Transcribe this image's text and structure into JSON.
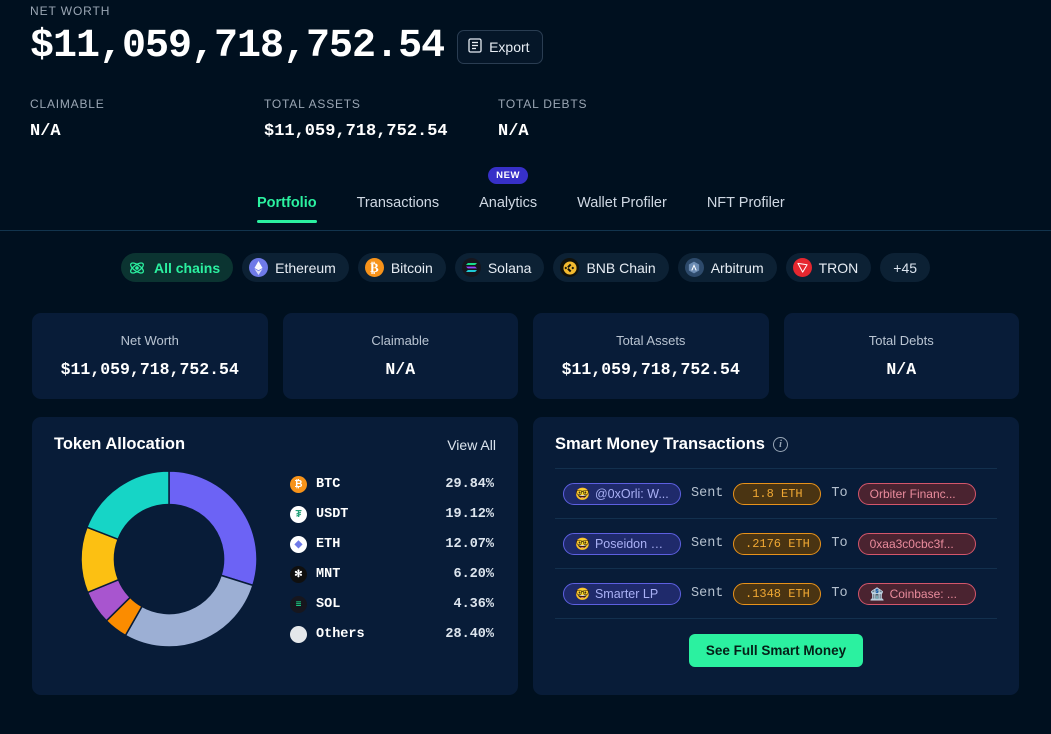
{
  "header": {
    "net_worth_label": "NET WORTH",
    "net_worth_value": "$11,059,718,752.54",
    "export_label": "Export",
    "sub_stats": [
      {
        "label": "CLAIMABLE",
        "value": "N/A"
      },
      {
        "label": "TOTAL ASSETS",
        "value": "$11,059,718,752.54"
      },
      {
        "label": "TOTAL DEBTS",
        "value": "N/A"
      }
    ]
  },
  "tabs": {
    "new_badge": "NEW",
    "items": [
      {
        "label": "Portfolio",
        "active": true
      },
      {
        "label": "Transactions",
        "active": false
      },
      {
        "label": "Analytics",
        "active": false
      },
      {
        "label": "Wallet Profiler",
        "active": false
      },
      {
        "label": "NFT Profiler",
        "active": false
      }
    ]
  },
  "chains": [
    {
      "label": "All chains",
      "icon": "atom-icon",
      "color": "#2bf1a0",
      "active": true
    },
    {
      "label": "Ethereum",
      "icon": "ethereum-icon",
      "color": "#6f7ae8",
      "active": false
    },
    {
      "label": "Bitcoin",
      "icon": "bitcoin-icon",
      "color": "#f7931a",
      "active": false
    },
    {
      "label": "Solana",
      "icon": "solana-icon",
      "color": "#1a1a2e",
      "active": false
    },
    {
      "label": "BNB Chain",
      "icon": "bnb-icon",
      "color": "#f3ba2f",
      "active": false
    },
    {
      "label": "Arbitrum",
      "icon": "arbitrum-icon",
      "color": "#2d4a6b",
      "active": false
    },
    {
      "label": "TRON",
      "icon": "tron-icon",
      "color": "#e6272f",
      "active": false
    },
    {
      "label": "+45",
      "icon": "",
      "color": "",
      "active": false
    }
  ],
  "stat_cards": [
    {
      "label": "Net Worth",
      "value": "$11,059,718,752.54"
    },
    {
      "label": "Claimable",
      "value": "N/A"
    },
    {
      "label": "Total Assets",
      "value": "$11,059,718,752.54"
    },
    {
      "label": "Total Debts",
      "value": "N/A"
    }
  ],
  "token_allocation": {
    "title": "Token Allocation",
    "view_all_label": "View All"
  },
  "chart_data": {
    "type": "pie",
    "title": "Token Allocation",
    "categories": [
      "BTC",
      "USDT",
      "ETH",
      "MNT",
      "SOL",
      "Others"
    ],
    "values": [
      29.84,
      19.12,
      12.07,
      6.2,
      4.36,
      28.4
    ],
    "labels": [
      "29.84%",
      "19.12%",
      "12.07%",
      "6.20%",
      "4.36%",
      "28.40%"
    ],
    "colors": [
      "#6c63f5",
      "#16d5c6",
      "#fcc012",
      "#a855cf",
      "#fb8c00",
      "#9cafd4"
    ],
    "legend_position": "right",
    "donut": true,
    "inner_radius_ratio": 0.62,
    "start_angle": -90,
    "direction": "clockwise",
    "segment_order": [
      "BTC",
      "Others",
      "SOL",
      "MNT",
      "ETH",
      "USDT"
    ]
  },
  "smart_money": {
    "title": "Smart Money Transactions",
    "info_icon": "info-icon",
    "sent_label": "Sent",
    "to_label": "To",
    "button_label": "See Full Smart Money",
    "rows": [
      {
        "actor_emoji": "🤓",
        "actor": "@0xOrli: W...",
        "action": "Sent",
        "amount": "1.8 ETH",
        "to_word": "To",
        "dest_emoji": "",
        "dest": "Orbiter Financ..."
      },
      {
        "actor_emoji": "🤓",
        "actor": "Poseidon D...",
        "action": "Sent",
        "amount": ".2176 ETH",
        "to_word": "To",
        "dest_emoji": "",
        "dest": "0xaa3c0cbc3f..."
      },
      {
        "actor_emoji": "🤓",
        "actor": "Smarter LP",
        "action": "Sent",
        "amount": ".1348 ETH",
        "to_word": "To",
        "dest_emoji": "🏦",
        "dest": "Coinbase: ..."
      }
    ]
  }
}
